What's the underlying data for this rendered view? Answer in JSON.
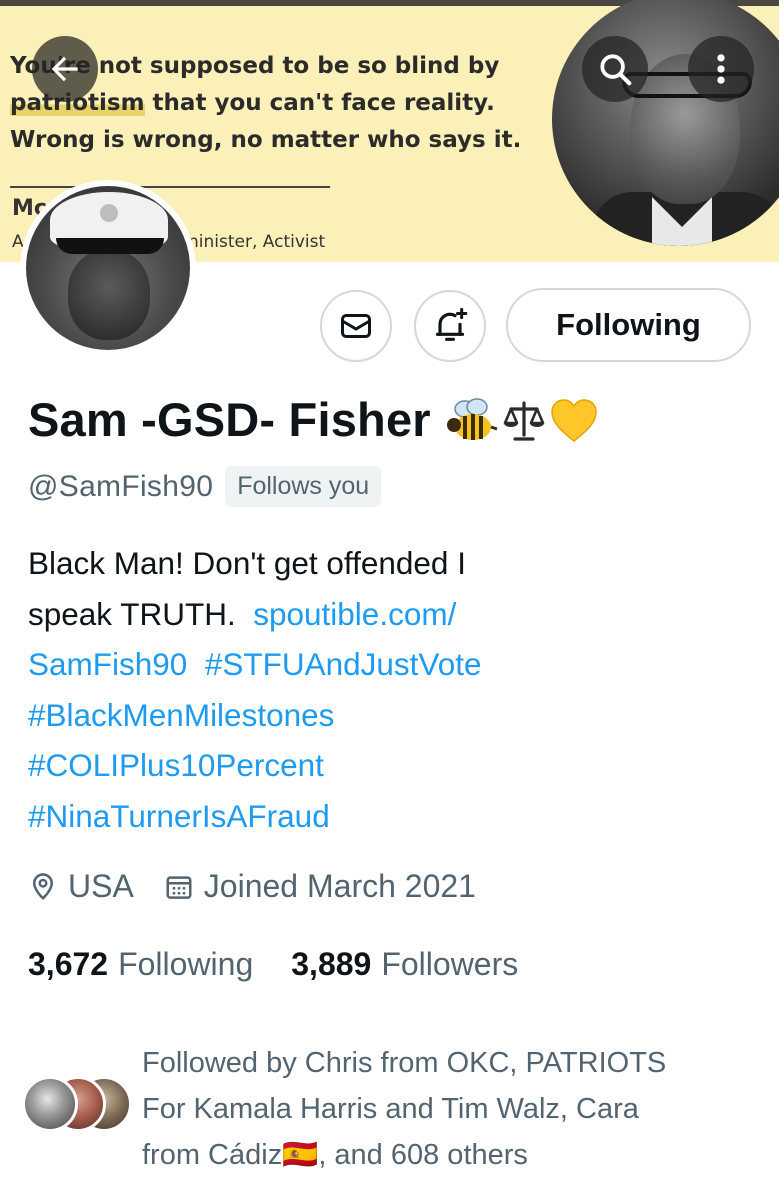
{
  "banner": {
    "quote_line1": "You're not supposed to be so blind by",
    "quote_line2_hl": "patriotism",
    "quote_line2_rest": " that you can't face reality.",
    "quote_line3": "Wrong is wrong, no matter who says it.",
    "author": "Mc",
    "role_start": "A",
    "role_tail": "ninister, Activist"
  },
  "nav": {
    "back_icon": "arrow-left-icon",
    "search_icon": "search-icon",
    "more_icon": "more-vertical-icon"
  },
  "actions": {
    "message_icon": "envelope-icon",
    "notify_icon": "bell-plus-icon",
    "following_label": "Following"
  },
  "profile": {
    "display_name": "Sam -GSD- Fisher",
    "name_emojis": [
      "🐝",
      "⚖",
      "💛"
    ],
    "handle": "@SamFish90",
    "follows_you": "Follows you",
    "bio_text_1": "Black Man! Don't get offended I",
    "bio_text_2": "speak TRUTH.",
    "bio_link_1a": "spoutible.com/",
    "bio_link_1b": "SamFish90",
    "hashtags": [
      "#STFUAndJustVote",
      "#BlackMenMilestones",
      "#COLIPlus10Percent",
      "#NinaTurnerIsAFraud"
    ],
    "location": "USA",
    "location_icon": "location-pin-icon",
    "joined": "Joined March 2021",
    "joined_icon": "calendar-icon"
  },
  "stats": {
    "following_count": "3,672",
    "following_label": "Following",
    "followers_count": "3,889",
    "followers_label": "Followers"
  },
  "followed_by": {
    "line1": "Followed by Chris from OKC, PATRIOTS",
    "line2": "For Kamala Harris and Tim Walz, Cara",
    "line3_a": "from Cádiz",
    "line3_flag": "🇪🇸",
    "line3_b": ", and 608 others"
  },
  "colors": {
    "link": "#1d9bf0",
    "secondary_text": "#536471",
    "primary_text": "#0f1419",
    "banner_bg": "#fbf1b8",
    "border": "#cfd9de"
  }
}
